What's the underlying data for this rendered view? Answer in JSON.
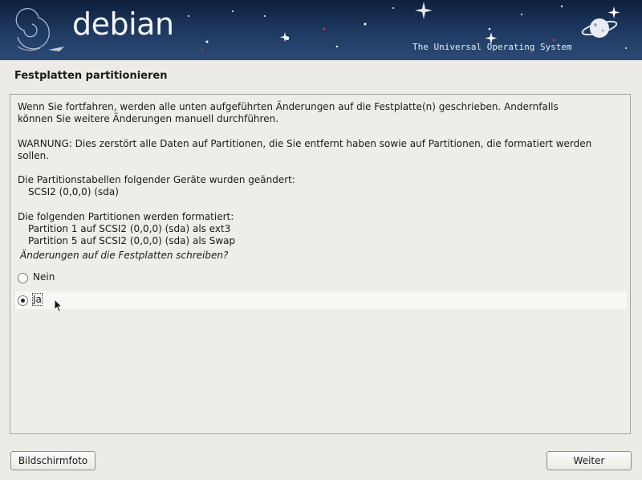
{
  "header": {
    "logo_text": "debian",
    "tagline": "The Universal Operating System"
  },
  "page": {
    "title": "Festplatten partitionieren"
  },
  "content": {
    "intro_line1": "Wenn Sie fortfahren, werden alle unten aufgeführten Änderungen auf die Festplatte(n) geschrieben. Andernfalls",
    "intro_line2": "können Sie weitere Änderungen manuell durchführen.",
    "warning_line1": "WARNUNG: Dies zerstört alle Daten auf Partitionen, die Sie entfernt haben sowie auf Partitionen, die formatiert werden",
    "warning_line2": "sollen.",
    "tables_heading": "Die Partitionstabellen folgender Geräte wurden geändert:",
    "tables_items": [
      "SCSI2 (0,0,0) (sda)"
    ],
    "format_heading": "Die folgenden Partitionen werden formatiert:",
    "format_items": [
      "Partition 1 auf SCSI2 (0,0,0) (sda) als ext3",
      "Partition 5 auf SCSI2 (0,0,0) (sda) als Swap"
    ],
    "question": "Änderungen auf die Festplatten schreiben?",
    "options": [
      {
        "label": "Nein",
        "selected": false
      },
      {
        "label": "Ja",
        "selected": true
      }
    ]
  },
  "footer": {
    "screenshot_button": "Bildschirmfoto",
    "continue_button": "Weiter"
  }
}
